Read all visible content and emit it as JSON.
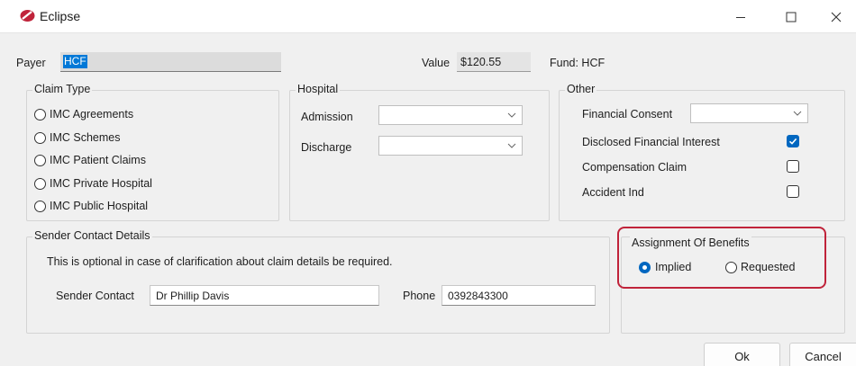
{
  "window": {
    "title": "Eclipse",
    "controls": {
      "minimize": "—",
      "maximize": "☐",
      "close": "✕"
    },
    "brand_color": "#c0233a"
  },
  "payer": {
    "label": "Payer",
    "value": "HCF"
  },
  "value": {
    "label": "Value",
    "amount": "$120.55"
  },
  "fund": {
    "text": "Fund: HCF"
  },
  "claim_type": {
    "legend": "Claim Type",
    "options": [
      "IMC Agreements",
      "IMC Schemes",
      "IMC Patient Claims",
      "IMC Private Hospital",
      "IMC Public Hospital"
    ]
  },
  "hospital": {
    "legend": "Hospital",
    "admission_label": "Admission",
    "admission_value": "",
    "discharge_label": "Discharge",
    "discharge_value": ""
  },
  "other": {
    "legend": "Other",
    "financial_consent_label": "Financial Consent",
    "financial_consent_value": "",
    "disclosed_label": "Disclosed Financial Interest",
    "disclosed_checked": true,
    "compensation_label": "Compensation Claim",
    "compensation_checked": false,
    "accident_label": "Accident Ind",
    "accident_checked": false
  },
  "sender": {
    "legend": "Sender Contact Details",
    "note": "This is optional in case of clarification about claim details be required.",
    "contact_label": "Sender Contact",
    "contact_value": "Dr Phillip Davis",
    "phone_label": "Phone",
    "phone_value": "0392843300"
  },
  "assignment": {
    "legend": "Assignment Of Benefits",
    "implied_label": "Implied",
    "requested_label": "Requested",
    "selected": "Implied",
    "highlight_color": "#c0233a"
  },
  "buttons": {
    "ok": "Ok",
    "cancel": "Cancel"
  },
  "accent_color": "#0067c0"
}
